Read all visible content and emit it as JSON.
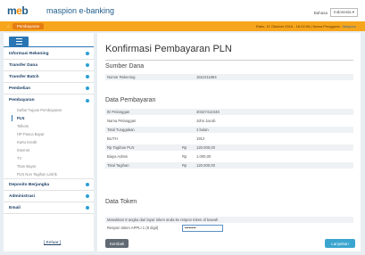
{
  "header": {
    "logo_main": "m",
    "logo_b": "∘",
    "logo_rest": "b",
    "brand": "maspion e-banking",
    "lang_label": "Bahasa",
    "lang_value": "Indonesia"
  },
  "breadcrumb": {
    "label": "Pembayaran",
    "session_text": "Rabu, 11 Oktober 2016 - 16:02:06 | Nama Pengguna : ",
    "session_user": "Maspion"
  },
  "sidebar": {
    "items": [
      {
        "label": "Informasi Rekening"
      },
      {
        "label": "Transfer Dana"
      },
      {
        "label": "Transfer Batch"
      },
      {
        "label": "Pembelian"
      }
    ],
    "pembayaran_label": "Pembayaran",
    "sub_items": [
      {
        "label": "Daftar Tujuan Pembayaran"
      },
      {
        "label": "PLN"
      },
      {
        "label": "Telkom"
      },
      {
        "label": "HP Pasca Bayar"
      },
      {
        "label": "Kartu Kredit"
      },
      {
        "label": "Internet"
      },
      {
        "label": "TV"
      },
      {
        "label": "Titan Bayar"
      },
      {
        "label": "PLN Non Tagihan Listrik"
      }
    ],
    "bottom_items": [
      {
        "label": "Deposito Berjangka"
      },
      {
        "label": "Administrasi"
      },
      {
        "label": "Email"
      }
    ],
    "logout_label": "[ Keluar ]"
  },
  "main": {
    "title": "Konfirmasi Pembayaran PLN",
    "sumber_title": "Sumber Dana",
    "sumber_rows": [
      {
        "label": "Nomor Rekening",
        "currency": "",
        "value": "1611011884"
      }
    ],
    "data_title": "Data Pembayaran",
    "data_rows": [
      {
        "label": "ID Pelanggan",
        "currency": "",
        "value": "4032741234S"
      },
      {
        "label": "Nama Pelanggan",
        "currency": "",
        "value": "John Jacob"
      },
      {
        "label": "Total Tunggakan",
        "currency": "",
        "value": "1 bulan"
      },
      {
        "label": "BLITH",
        "currency": "",
        "value": "1912"
      },
      {
        "label": "Rp Tagihan PLN",
        "currency": "Rp",
        "value": "120.000,00"
      },
      {
        "label": "Biaya Admin",
        "currency": "Rp",
        "value": "1.000,00"
      },
      {
        "label": "Total Tagihan",
        "currency": "Rp",
        "value": "120.000,00"
      }
    ],
    "token_title": "Data Token",
    "token_hint": "Masukkan 8 angka dari layar token anda ke respon token di bawah",
    "token_label": "Respon token APPLI 1 (8 digit)",
    "token_value": "••••••••",
    "back_label": "Kembali",
    "next_label": "Lanjutkan"
  }
}
